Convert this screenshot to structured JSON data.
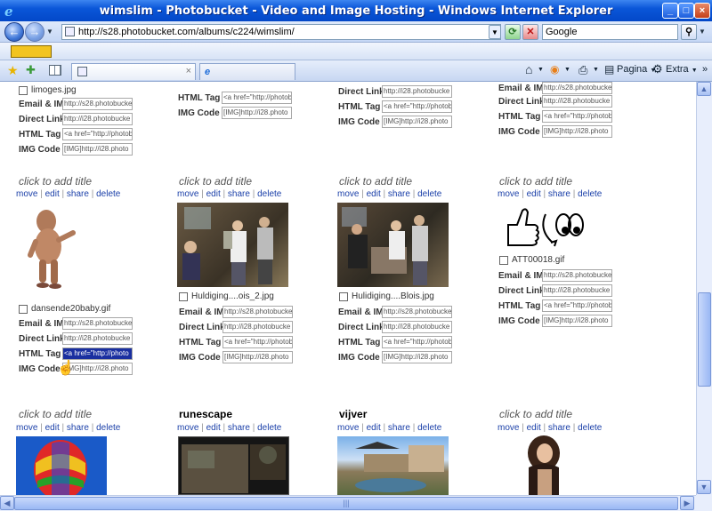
{
  "window": {
    "title": "wimslim - Photobucket - Video and Image Hosting - Windows Internet Explorer"
  },
  "address": {
    "url": "http://s28.photobucket.com/albums/c224/wimslim/",
    "search_placeholder": "Google"
  },
  "toolbar": {
    "pagina": "Pagina",
    "extra": "Extra"
  },
  "labels": {
    "email": "Email & IM",
    "direct": "Direct Link",
    "html": "HTML Tag",
    "img": "IMG Code",
    "click_title": "click to add title",
    "move": "move",
    "edit": "edit",
    "share": "share",
    "delete": "delete"
  },
  "values": {
    "email": "http://s28.photobucke",
    "direct": "http://i28.photobucke",
    "html": "<a href=\"http://photob",
    "html_short": "<a href=\"http://photo",
    "img": "[IMG]http://i28.photo"
  },
  "row1": {
    "filename_col1": "limoges.jpg"
  },
  "row2": {
    "col1": {
      "filename": "dansende20baby.gif"
    },
    "col2": {
      "filename": "Huldiging....ois_2.jpg"
    },
    "col3": {
      "filename": "Hulidiging....Blois.jpg"
    },
    "col4": {
      "filename": "ATT00018.gif"
    }
  },
  "row3": {
    "col2_title": "runescape",
    "col3_title": "vijver"
  }
}
